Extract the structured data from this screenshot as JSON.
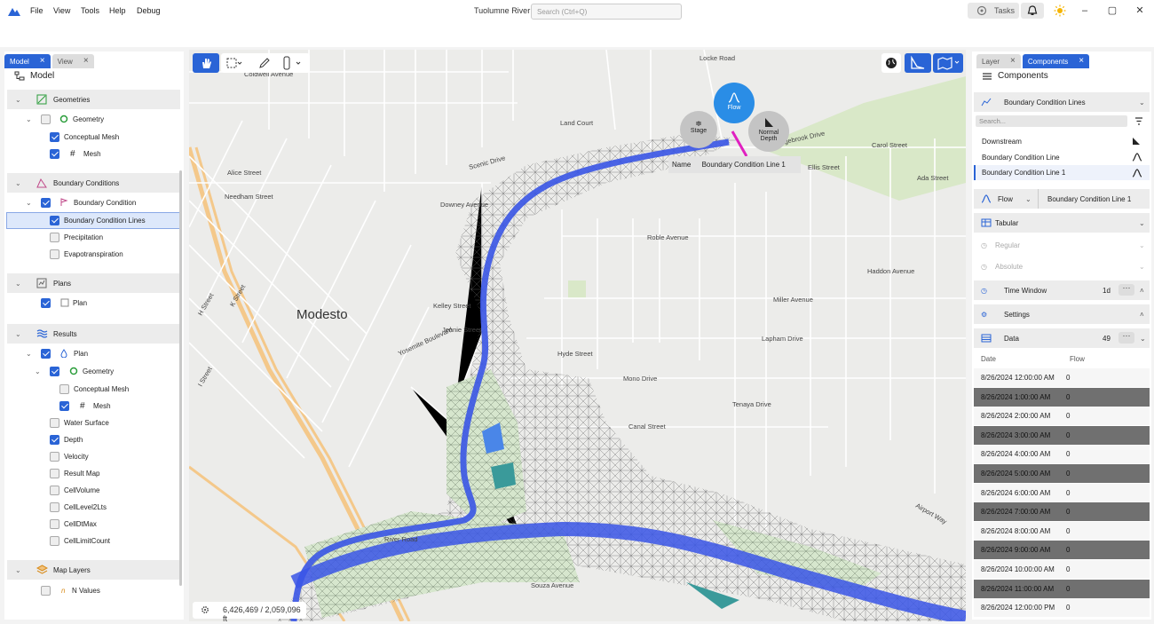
{
  "menu": {
    "file": "File",
    "view": "View",
    "tools": "Tools",
    "help": "Help",
    "debug": "Debug"
  },
  "window": {
    "title": "Tuolumne River",
    "search_placeholder": "Search (Ctrl+Q)",
    "tasks": "Tasks"
  },
  "left": {
    "tabs": [
      {
        "label": "Model"
      },
      {
        "label": "View"
      }
    ],
    "header": "Model",
    "items": {
      "geometries": "Geometries",
      "geometry": "Geometry",
      "conceptual_mesh": "Conceptual Mesh",
      "mesh": "Mesh",
      "boundary_conditions": "Boundary Conditions",
      "boundary_condition": "Boundary Condition",
      "bc_lines": "Boundary Condition Lines",
      "precipitation": "Precipitation",
      "evapotranspiration": "Evapotranspiration",
      "plans": "Plans",
      "plan": "Plan",
      "results": "Results",
      "r_plan": "Plan",
      "r_geometry": "Geometry",
      "r_conceptual_mesh": "Conceptual Mesh",
      "r_mesh": "Mesh",
      "water_surface": "Water Surface",
      "depth": "Depth",
      "velocity": "Velocity",
      "result_map": "Result Map",
      "cell_volume": "CellVolume",
      "cell_level": "CellLevel2Lts",
      "cell_dt": "CellDtMax",
      "cell_limit": "CellLimitCount",
      "map_layers": "Map Layers",
      "n_values": "N Values"
    }
  },
  "map": {
    "city": "Modesto",
    "coords": "6,426,469  /  2,059,096 ft",
    "bc_name_label": "Name",
    "bc_name_value": "Boundary Condition Line 1",
    "fab": {
      "flow": "Flow",
      "stage": "Stage",
      "normal_depth_1": "Normal",
      "normal_depth_2": "Depth"
    },
    "streets": {
      "locke": "Locke Road",
      "coldwell": "Coldwell Avenue",
      "scenic": "Scenic Drive",
      "needham": "Needham Street",
      "downey": "Downey Avenue",
      "roble": "Roble Avenue",
      "kelley": "Kelley Street",
      "jennie": "Jennie Street",
      "yosemite": "Yosemite Boulevard",
      "hyde": "Hyde Street",
      "mono": "Mono Drive",
      "lapham": "Lapham Drive",
      "miller": "Miller Avenue",
      "haddon": "Haddon Avenue",
      "edgebrook": "Edgebrook Drive",
      "ellis": "Ellis Street",
      "carol": "Carol Street",
      "ada": "Ada Street",
      "canal": "Canal Street",
      "tenaya": "Tenaya Drive",
      "river": "River Road",
      "souza": "Souza Avenue",
      "college": "College Avenue",
      "land": "Land Court",
      "alice": "Alice Street",
      "airport": "Airport Way",
      "i_street": "I Street",
      "k_street": "K Street",
      "h_street": "H Street"
    }
  },
  "right": {
    "tabs": [
      {
        "label": "Layer"
      },
      {
        "label": "Components"
      }
    ],
    "header": "Components",
    "section": "Boundary Condition Lines",
    "search_placeholder": "Search...",
    "items": [
      "Downstream",
      "Boundary Condition Line",
      "Boundary Condition Line 1"
    ],
    "flow_type": "Flow",
    "flow_target": "Boundary Condition Line 1",
    "tabular": "Tabular",
    "regular": "Regular",
    "absolute": "Absolute",
    "time_window": "Time Window",
    "time_window_value": "1d",
    "settings": "Settings",
    "data": "Data",
    "data_count": "49",
    "col_date": "Date",
    "col_flow": "Flow",
    "rows": [
      {
        "date": "8/26/2024 12:00:00 AM",
        "flow": "0"
      },
      {
        "date": "8/26/2024 1:00:00 AM",
        "flow": "0"
      },
      {
        "date": "8/26/2024 2:00:00 AM",
        "flow": "0"
      },
      {
        "date": "8/26/2024 3:00:00 AM",
        "flow": "0"
      },
      {
        "date": "8/26/2024 4:00:00 AM",
        "flow": "0"
      },
      {
        "date": "8/26/2024 5:00:00 AM",
        "flow": "0"
      },
      {
        "date": "8/26/2024 6:00:00 AM",
        "flow": "0"
      },
      {
        "date": "8/26/2024 7:00:00 AM",
        "flow": "0"
      },
      {
        "date": "8/26/2024 8:00:00 AM",
        "flow": "0"
      },
      {
        "date": "8/26/2024 9:00:00 AM",
        "flow": "0"
      },
      {
        "date": "8/26/2024 10:00:00 AM",
        "flow": "0"
      },
      {
        "date": "8/26/2024 11:00:00 AM",
        "flow": "0"
      },
      {
        "date": "8/26/2024 12:00:00 PM",
        "flow": "0"
      }
    ]
  },
  "colors": {
    "accent": "#2a64d6",
    "river": "#3a55e6",
    "flow_fab": "#2a8de6"
  }
}
